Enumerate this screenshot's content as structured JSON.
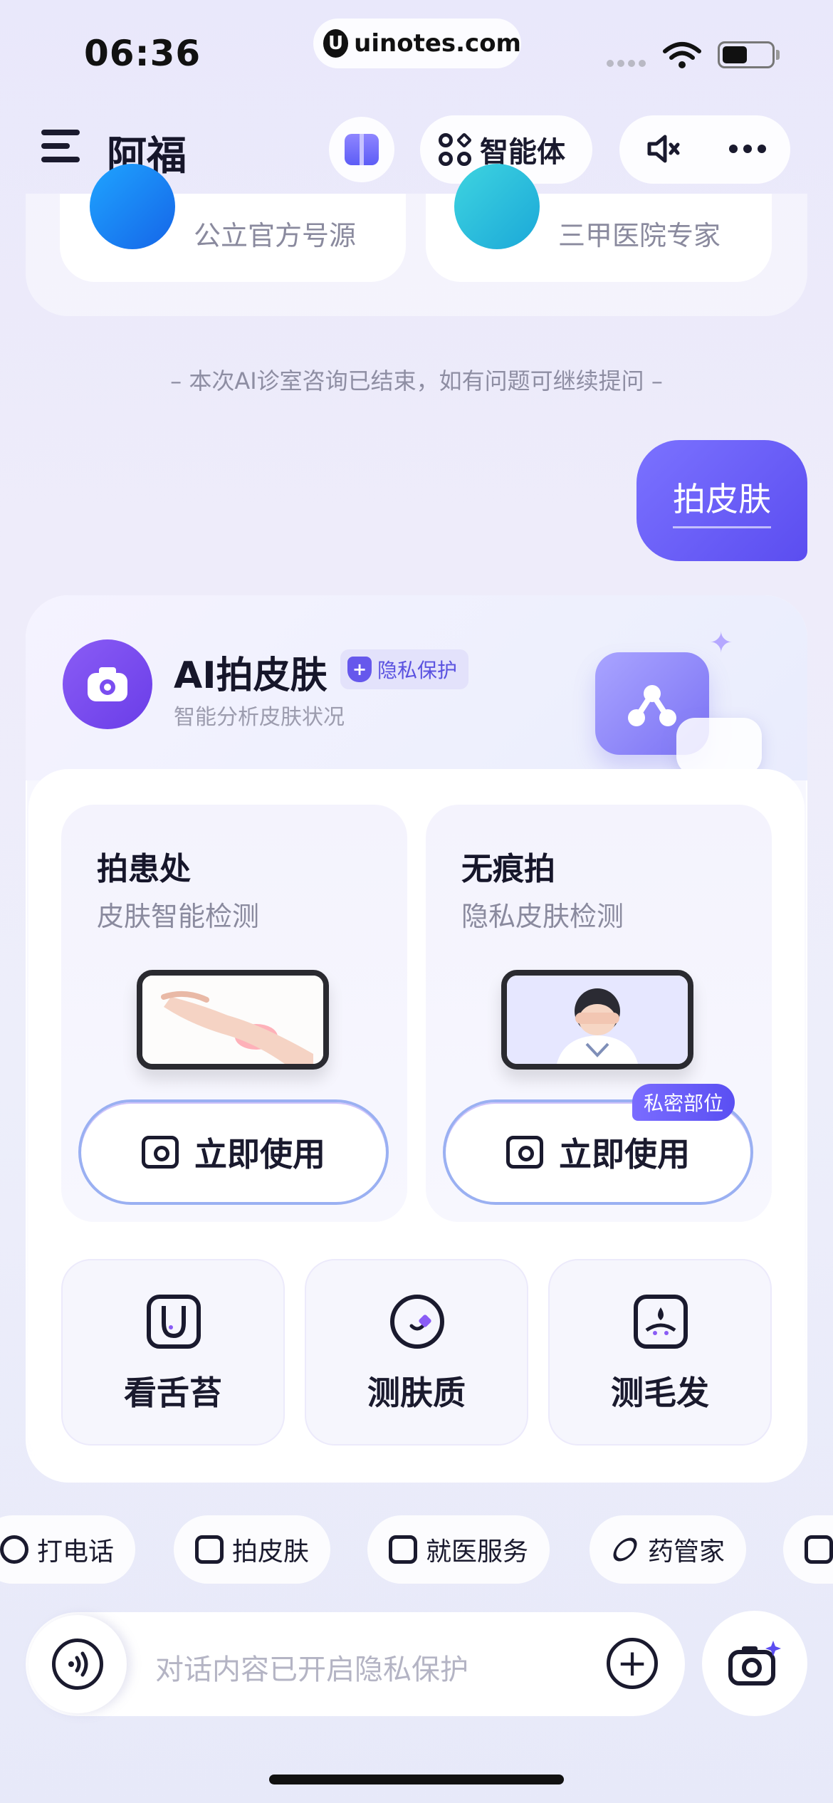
{
  "status_bar": {
    "time": "06:36",
    "url": "uinotes.com",
    "url_logo": "U"
  },
  "header": {
    "title": "阿福",
    "agent_label": "智能体"
  },
  "top_cards": [
    {
      "subtitle": "公立官方号源",
      "icon": "hospital-card-icon"
    },
    {
      "subtitle": "三甲医院专家",
      "icon": "doctor-icon"
    }
  ],
  "session_note": "–   本次AI诊室咨询已结束，如有问题可继续提问   –",
  "user_message": "拍皮肤",
  "ai_card": {
    "title": "AI拍皮肤",
    "privacy_badge": "隐私保护",
    "shield_glyph": "+",
    "subtitle": "智能分析皮肤状况",
    "options": [
      {
        "title": "拍患处",
        "subtitle": "皮肤智能检测",
        "button": "立即使用"
      },
      {
        "title": "无痕拍",
        "subtitle": "隐私皮肤检测",
        "button": "立即使用",
        "tag": "私密部位"
      }
    ],
    "tools": [
      {
        "label": "看舌苔",
        "icon": "tongue-icon"
      },
      {
        "label": "测肤质",
        "icon": "skin-scan-icon"
      },
      {
        "label": "测毛发",
        "icon": "hair-icon"
      }
    ]
  },
  "quick_actions": [
    "打电话",
    "拍皮肤",
    "就医服务",
    "药管家"
  ],
  "input": {
    "placeholder": "对话内容已开启隐私保护",
    "plus": "+"
  },
  "colors": {
    "accent": "#5b4df0",
    "text": "#1a1a2e",
    "muted": "#8a8a9e"
  }
}
